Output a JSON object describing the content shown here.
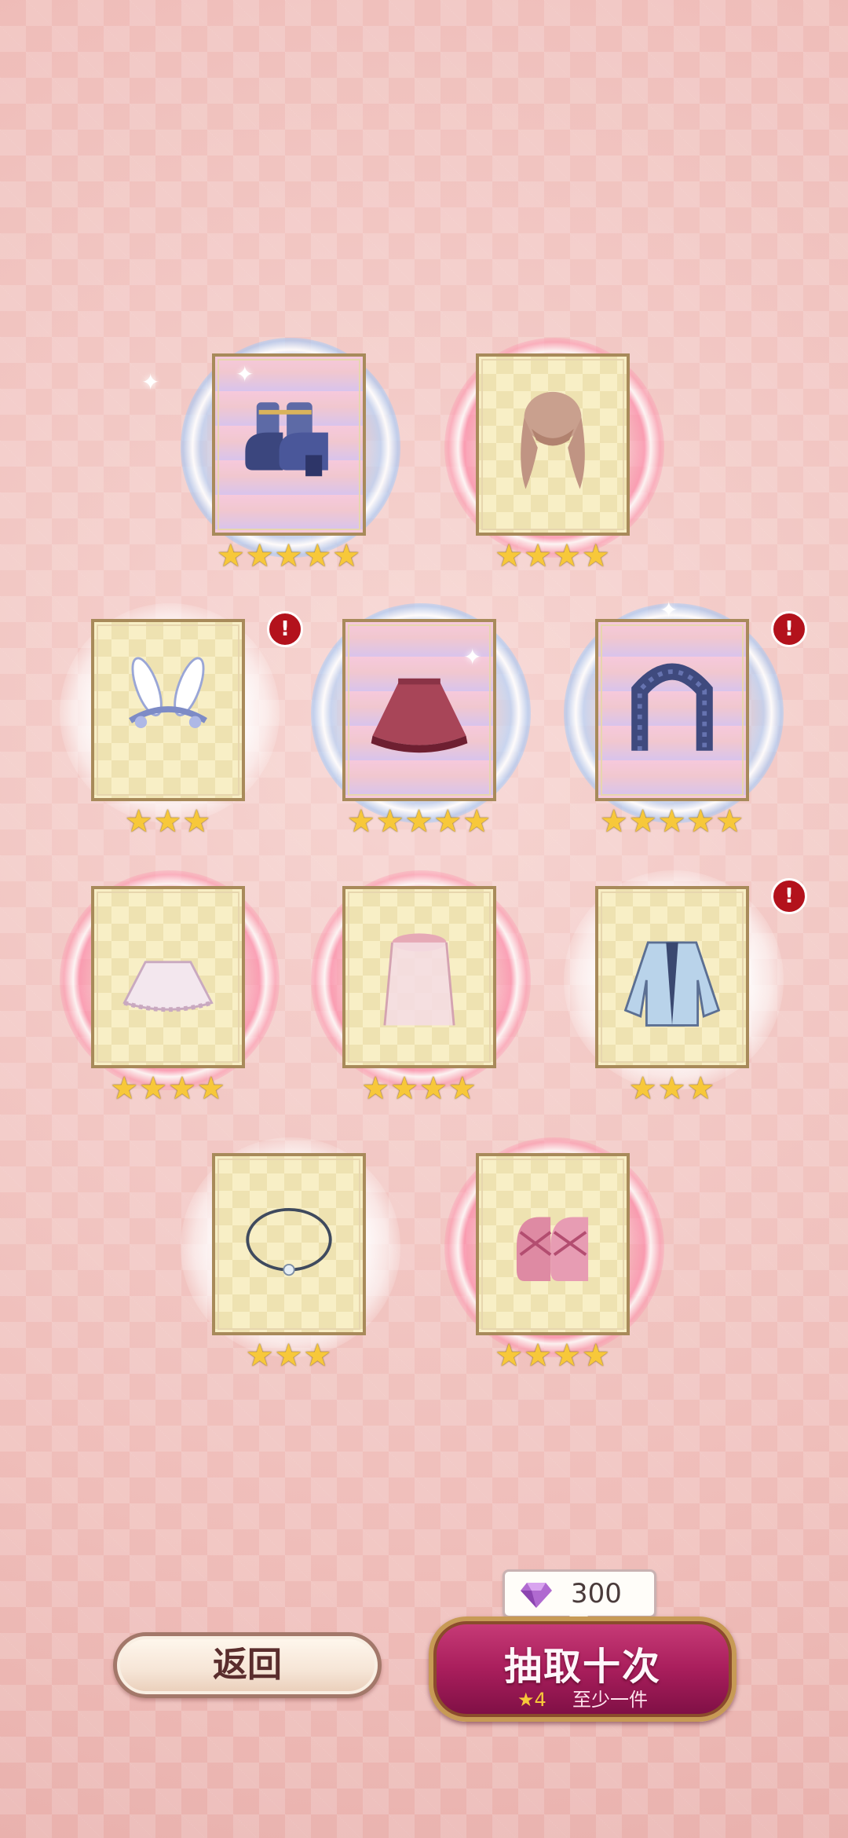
{
  "items": [
    {
      "name": "shoes-item",
      "stars": "★★★★★",
      "rarity": "rare",
      "new": false
    },
    {
      "name": "hair-item",
      "stars": "★★★★",
      "rarity": "normal",
      "new": false
    },
    {
      "name": "bunny-headband-item",
      "stars": "★★★",
      "rarity": "normal",
      "new": true
    },
    {
      "name": "red-skirt-item",
      "stars": "★★★★★",
      "rarity": "rare",
      "new": false
    },
    {
      "name": "collar-chain-item",
      "stars": "★★★★★",
      "rarity": "rare",
      "new": true
    },
    {
      "name": "petticoat-item",
      "stars": "★★★★",
      "rarity": "normal",
      "new": false
    },
    {
      "name": "veil-item",
      "stars": "★★★★",
      "rarity": "normal",
      "new": false
    },
    {
      "name": "jacket-item",
      "stars": "★★★",
      "rarity": "normal",
      "new": true
    },
    {
      "name": "necklace-item",
      "stars": "★★★",
      "rarity": "normal",
      "new": false
    },
    {
      "name": "pink-shoes-item",
      "stars": "★★★★",
      "rarity": "normal",
      "new": false
    }
  ],
  "new_badge": "!",
  "buttons": {
    "back_label": "返回",
    "draw_label": "抽取十次",
    "guarantee_star": "★4",
    "guarantee_text": "至少一件"
  },
  "cost": {
    "icon": "diamond-gem-icon",
    "value": "300"
  },
  "colors": {
    "rare_star": "#f7c83a",
    "draw_button": "#a91e5c",
    "badge": "#b3121c"
  }
}
